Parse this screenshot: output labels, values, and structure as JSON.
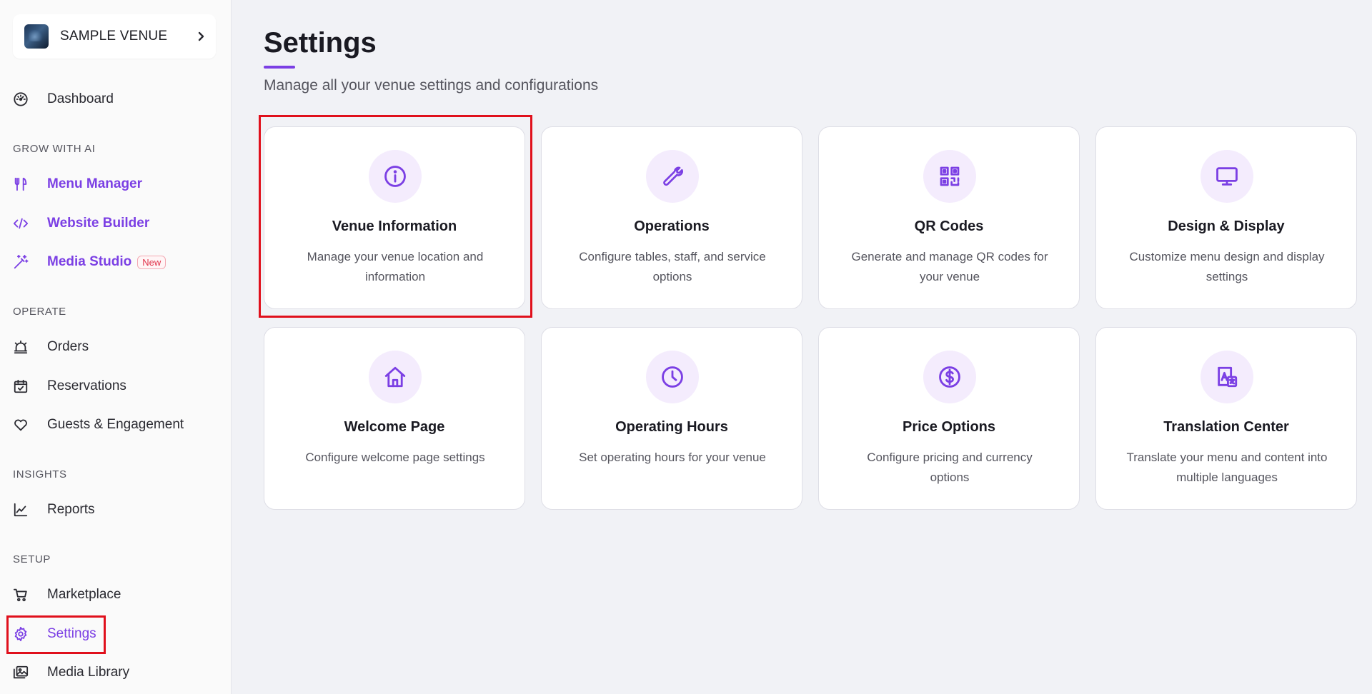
{
  "sidebar": {
    "venue": {
      "name": "SAMPLE VENUE",
      "logo_icon": "venue-photo-thumbnail",
      "chevron_icon": "chevron-right-icon"
    },
    "dashboard": {
      "label": "Dashboard",
      "icon": "gauge-icon"
    },
    "sections": {
      "grow": "GROW WITH AI",
      "operate": "OPERATE",
      "insights": "INSIGHTS",
      "setup": "SETUP"
    },
    "grow_items": [
      {
        "label": "Menu Manager",
        "icon": "utensils-icon"
      },
      {
        "label": "Website Builder",
        "icon": "code-icon"
      },
      {
        "label": "Media Studio",
        "icon": "magic-wand-icon",
        "badge": "New"
      }
    ],
    "operate_items": [
      {
        "label": "Orders",
        "icon": "bell-icon"
      },
      {
        "label": "Reservations",
        "icon": "calendar-check-icon"
      },
      {
        "label": "Guests & Engagement",
        "icon": "heart-icon"
      }
    ],
    "insights_items": [
      {
        "label": "Reports",
        "icon": "line-chart-icon"
      }
    ],
    "setup_items": [
      {
        "label": "Marketplace",
        "icon": "cart-icon"
      },
      {
        "label": "Settings",
        "icon": "gear-icon",
        "active": true
      },
      {
        "label": "Media Library",
        "icon": "images-icon"
      }
    ]
  },
  "main": {
    "title": "Settings",
    "subtitle": "Manage all your venue settings and configurations",
    "cards": [
      {
        "title": "Venue Information",
        "desc": "Manage your venue location and information",
        "icon": "info-circle-icon"
      },
      {
        "title": "Operations",
        "desc": "Configure tables, staff, and service options",
        "icon": "wrench-icon"
      },
      {
        "title": "QR Codes",
        "desc": "Generate and manage QR codes for your venue",
        "icon": "qr-code-icon"
      },
      {
        "title": "Design & Display",
        "desc": "Customize menu design and display settings",
        "icon": "monitor-icon"
      },
      {
        "title": "Welcome Page",
        "desc": "Configure welcome page settings",
        "icon": "home-icon"
      },
      {
        "title": "Operating Hours",
        "desc": "Set operating hours for your venue",
        "icon": "clock-icon"
      },
      {
        "title": "Price Options",
        "desc": "Configure pricing and currency options",
        "icon": "dollar-circle-icon"
      },
      {
        "title": "Translation Center",
        "desc": "Translate your menu and content into multiple languages",
        "icon": "translate-icon"
      }
    ]
  },
  "colors": {
    "accent": "#7b3fe4",
    "icon_bg": "#f4ecfd",
    "highlight": "#e0101c",
    "page_bg": "#f1f2f6"
  }
}
